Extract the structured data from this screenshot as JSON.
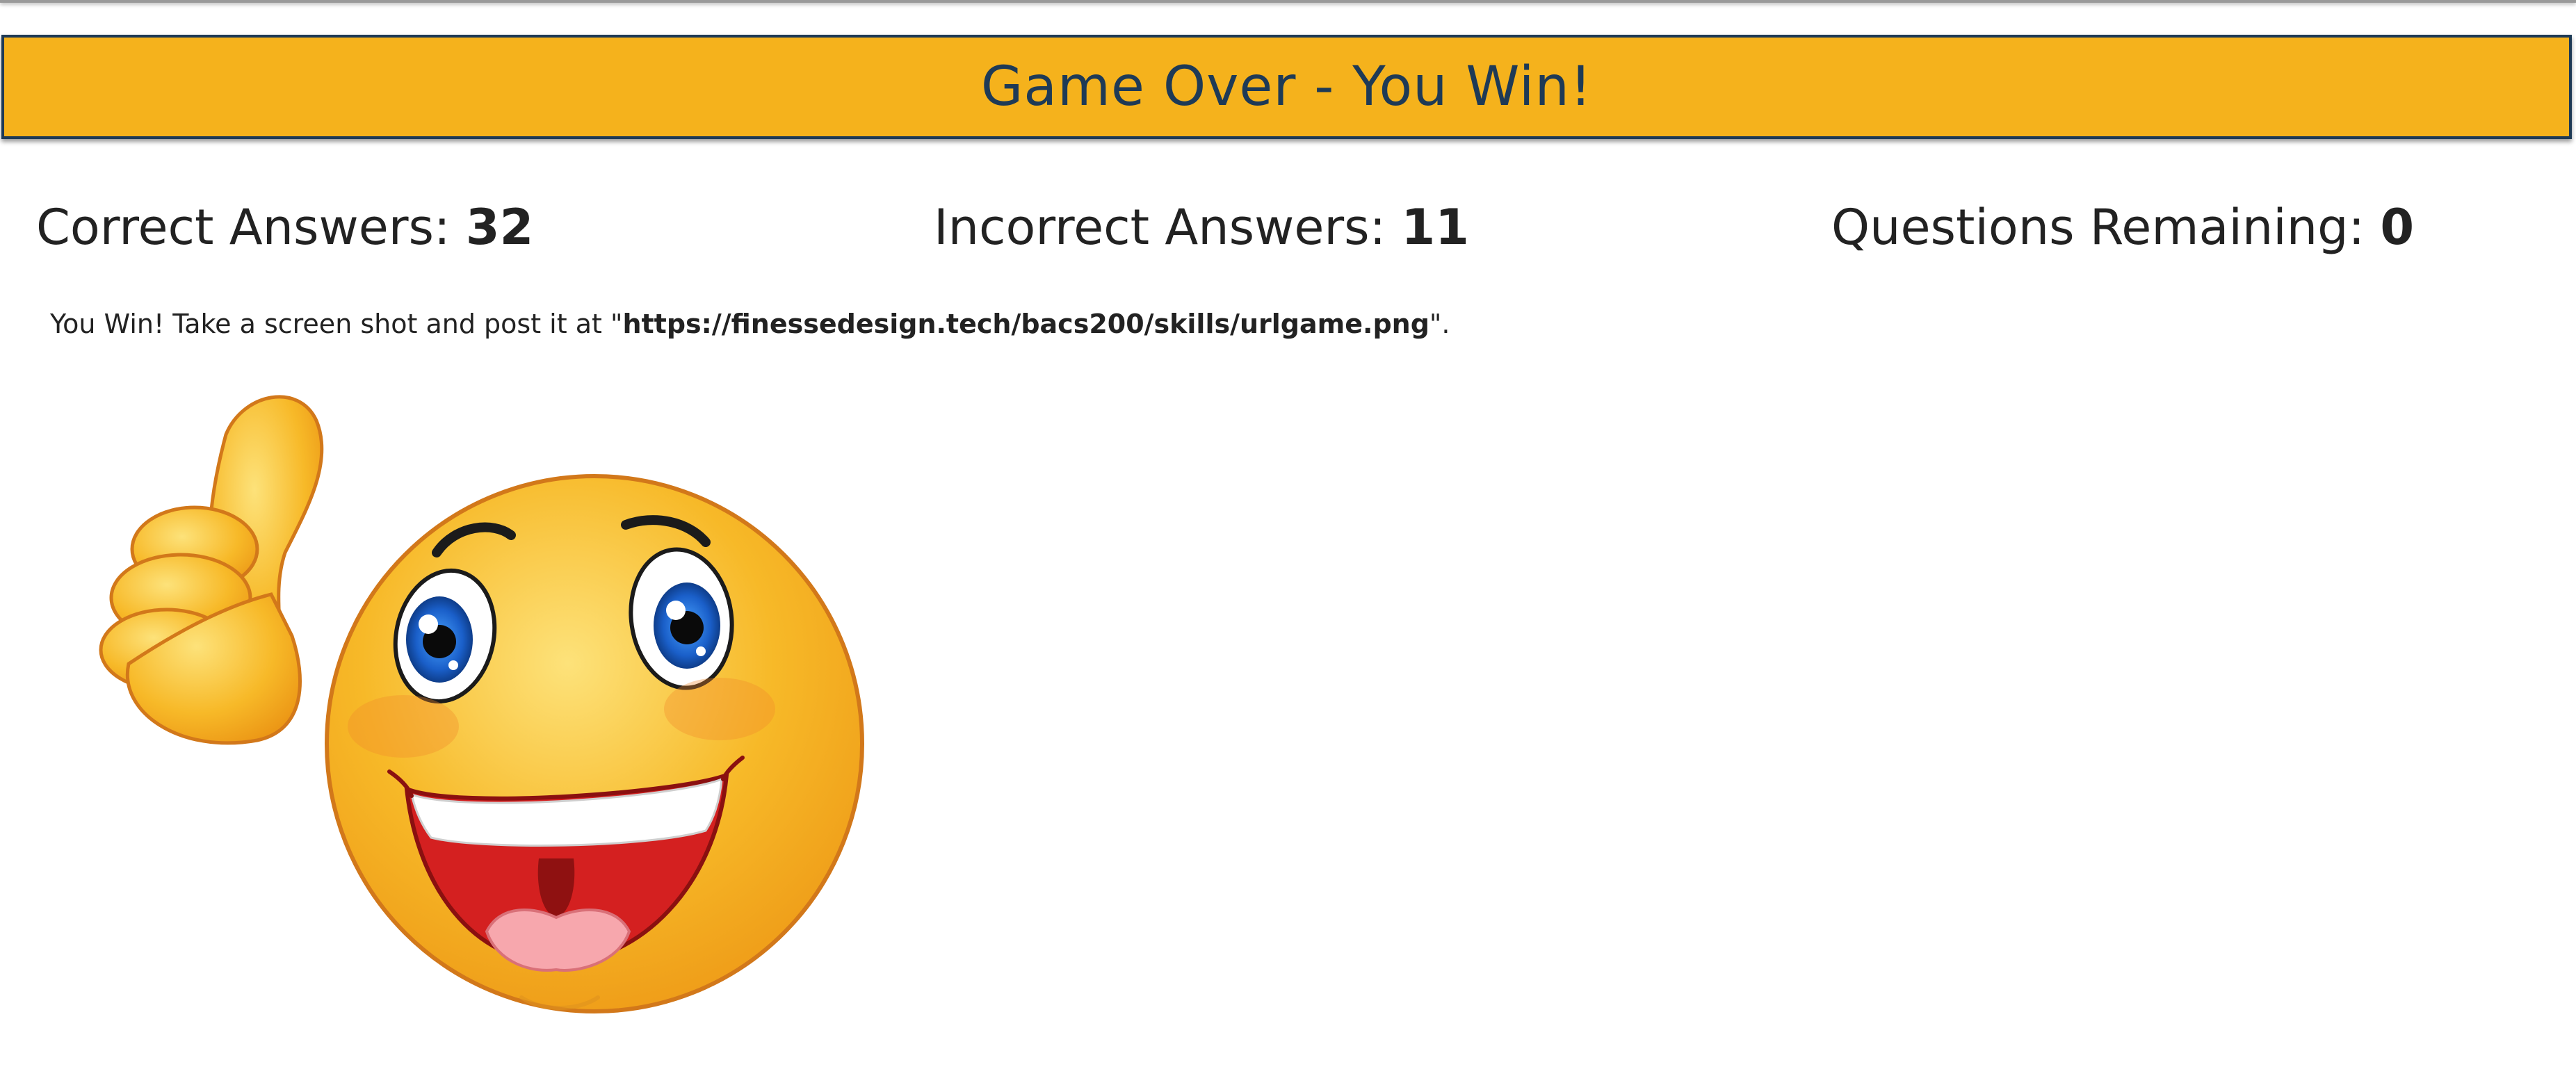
{
  "page": {
    "title": "Game Over - You Win!"
  },
  "scoreboard": {
    "correct_label": "Correct Answers:",
    "correct_value": "32",
    "incorrect_label": "Incorrect Answers:",
    "incorrect_value": "11",
    "remaining_label": "Questions Remaining:",
    "remaining_value": "0"
  },
  "message": {
    "prefix": "You Win! Take a screen shot and post it at \"",
    "url": "https://finessedesign.tech/bacs200/skills/urlgame.png",
    "suffix": "\"."
  },
  "image": {
    "icon": "thumbs-up-smiley-icon"
  },
  "colors": {
    "banner_bg": "#f5b21c",
    "banner_text": "#1e3a56",
    "smiley_yellow": "#f7b928"
  }
}
